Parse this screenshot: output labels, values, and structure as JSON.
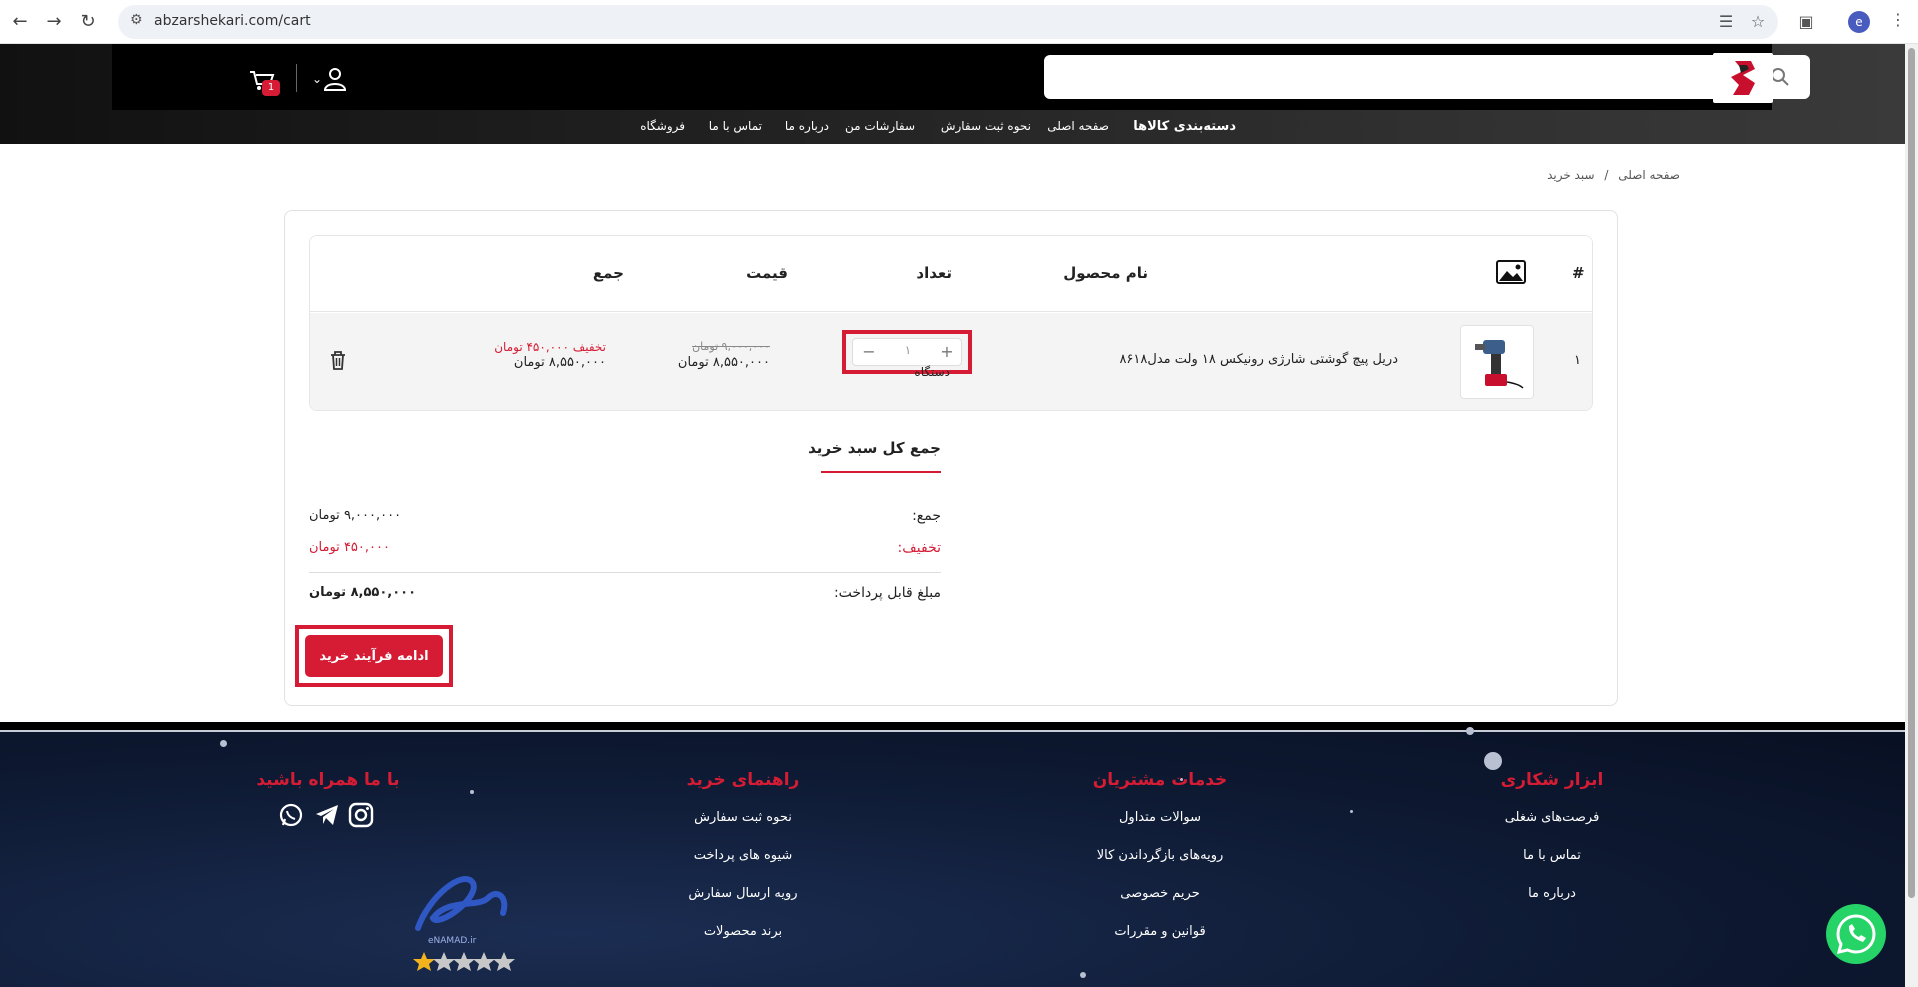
{
  "browser": {
    "url": "abzarshekari.com/cart",
    "profile_initial": "e"
  },
  "header": {
    "search_placeholder": "جستجو",
    "cart_count": "1",
    "nav": [
      {
        "label": "دسته‌بندی کالاها"
      },
      {
        "label": "صفحه اصلی"
      },
      {
        "label": "نحوه ثبت سفارش"
      },
      {
        "label": "سفارشات من"
      },
      {
        "label": "درباره ما"
      },
      {
        "label": "تماس با ما"
      },
      {
        "label": "فروشگاه"
      }
    ]
  },
  "breadcrumb": {
    "home": "صفحه اصلی",
    "separator": "/",
    "current": "سبد خرید"
  },
  "cart": {
    "columns": {
      "index": "#",
      "name": "نام محصول",
      "qty": "تعداد",
      "price": "قیمت",
      "total": "جمع"
    },
    "items": [
      {
        "index": "۱",
        "name": "دریل پیچ گوشتی شارژی رونیکس ۱۸ ولت مدل۸۶۱۸",
        "qty": "۱",
        "unit": "دستگاه",
        "old_price": "۹,۰۰۰,۰۰۰ تومان",
        "price": "۸,۵۵۰,۰۰۰ تومان",
        "discount": "تخفیف ۴۵۰,۰۰۰ تومان",
        "total": "۸,۵۵۰,۰۰۰ تومان"
      }
    ]
  },
  "totals": {
    "title": "جمع کل سبد خرید",
    "sum_label": "جمع:",
    "sum_value": "۹,۰۰۰,۰۰۰ تومان",
    "discount_label": "تخفیف:",
    "discount_value": "۴۵۰,۰۰۰ تومان",
    "payable_label": "مبلغ قابل پرداخت:",
    "payable_value": "۸,۵۵۰,۰۰۰ تومان",
    "checkout_label": "ادامه فرآیند خرید"
  },
  "footer": {
    "col1": {
      "title": "ابزار شکاری",
      "links": [
        "فرصت‌های شغلی",
        "تماس با ما",
        "درباره ما"
      ]
    },
    "col2": {
      "title": "خدمات مشتریان",
      "links": [
        "سوالات متداول",
        "رویه‌های بازگرداندن کالا",
        "حریم خصوصی",
        "قوانین و مقررات"
      ]
    },
    "col3": {
      "title": "راهنمای خرید",
      "links": [
        "نحوه ثبت سفارش",
        "شیوه های پرداخت",
        "رویه ارسال سفارش",
        "برند محصولات"
      ]
    },
    "col4": {
      "title": "با ما همراه باشید"
    },
    "enamad_text": "eNAMAD.ir"
  },
  "colors": {
    "accent": "#d61c35",
    "header_bg": "#000000",
    "footer_bg": "#0e1a33"
  }
}
